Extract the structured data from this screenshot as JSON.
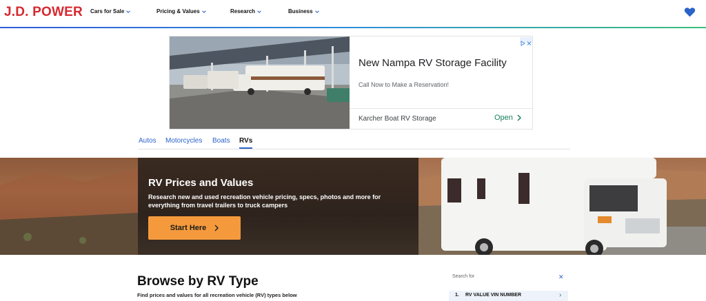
{
  "header": {
    "logo": "J.D. POWER",
    "nav": [
      {
        "label": "Cars for Sale"
      },
      {
        "label": "Pricing & Values"
      },
      {
        "label": "Research"
      },
      {
        "label": "Business"
      }
    ],
    "favorites_icon": "heart-icon"
  },
  "ad": {
    "headline": "New Nampa RV Storage Facility",
    "subtext": "Call Now to Make a Reservation!",
    "advertiser": "Karcher Boat RV Storage",
    "cta": "Open",
    "badge_icons": [
      "adchoices-icon",
      "close-icon"
    ]
  },
  "tabs": [
    {
      "label": "Autos",
      "active": false
    },
    {
      "label": "Motorcycles",
      "active": false
    },
    {
      "label": "Boats",
      "active": false
    },
    {
      "label": "RVs",
      "active": true
    }
  ],
  "hero": {
    "title": "RV Prices and Values",
    "description": "Research new and used recreation vehicle pricing, specs, photos and more for everything from travel trailers to truck campers",
    "cta": "Start Here"
  },
  "browse": {
    "title": "Browse by RV Type",
    "description": "Find prices and values for all recreation vehicle (RV) types below"
  },
  "search_panel": {
    "label": "Search for",
    "results": [
      {
        "number": "1.",
        "text": "RV VALUE VIN NUMBER"
      }
    ]
  },
  "colors": {
    "brand_red": "#d7282f",
    "link_blue": "#2b63c9",
    "cta_orange": "#f59a3c",
    "ad_green": "#1a7f5f"
  }
}
